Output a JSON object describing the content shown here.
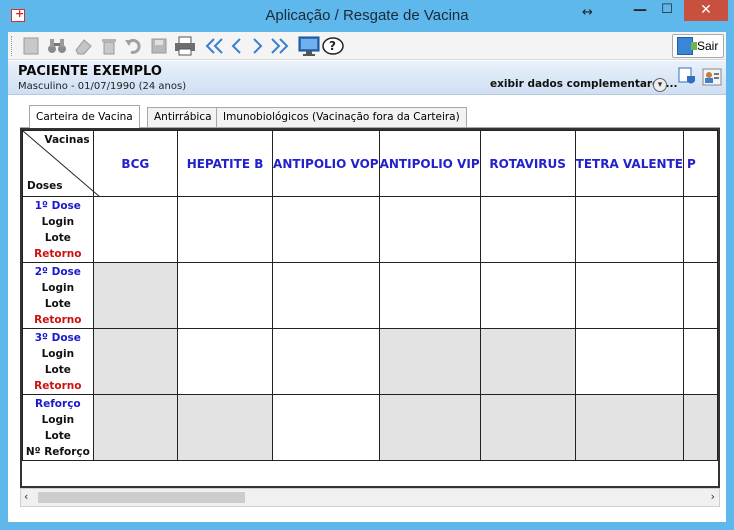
{
  "window": {
    "title": "Aplicação / Resgate de Vacina",
    "close_glyph": "✕",
    "minimize_glyph": "—",
    "maximize_glyph": "☐",
    "restore_glyph": "↔"
  },
  "toolbar": {
    "icons": [
      "new-icon",
      "binoculars-icon",
      "eraser-icon",
      "trash-icon",
      "undo-icon",
      "save-icon",
      "print-icon",
      "first-icon",
      "prev-icon",
      "next-icon",
      "last-icon",
      "monitor-icon",
      "help-icon"
    ],
    "sair_label": "Sair"
  },
  "patient": {
    "name": "PACIENTE EXEMPLO",
    "info": "Masculino - 01/07/1990 (24 anos)",
    "exibir_label": "exibir dados complementares..."
  },
  "tabs": [
    {
      "label": "Carteira de Vacina",
      "active": true
    },
    {
      "label": "Antirrábica",
      "active": false
    },
    {
      "label": "Imunobiológicos (Vacinação fora da Carteira)",
      "active": false
    }
  ],
  "grid": {
    "corner_vacinas": "Vacinas",
    "corner_doses": "Doses",
    "columns": [
      "BCG",
      "HEPATITE B",
      "ANTIPOLIO VOP",
      "ANTIPOLIO VIP",
      "ROTAVIRUS",
      "TETRA VALENTE",
      "P"
    ],
    "rows": [
      {
        "dose": "1º Dose",
        "login": "Login",
        "lote": "Lote",
        "extra": "Retorno",
        "extra_color": "red"
      },
      {
        "dose": "2º Dose",
        "login": "Login",
        "lote": "Lote",
        "extra": "Retorno",
        "extra_color": "red"
      },
      {
        "dose": "3º Dose",
        "login": "Login",
        "lote": "Lote",
        "extra": "Retorno",
        "extra_color": "red"
      },
      {
        "dose": "Reforço",
        "login": "Login",
        "lote": "Lote",
        "extra": "Nº Reforço",
        "extra_color": "black"
      }
    ]
  },
  "colors": {
    "titlebar": "#5fb8ec",
    "close": "#c7503f",
    "header_text": "#2222cc",
    "disabled_cell": "#e3e3e3",
    "retorno": "#cc1111"
  }
}
